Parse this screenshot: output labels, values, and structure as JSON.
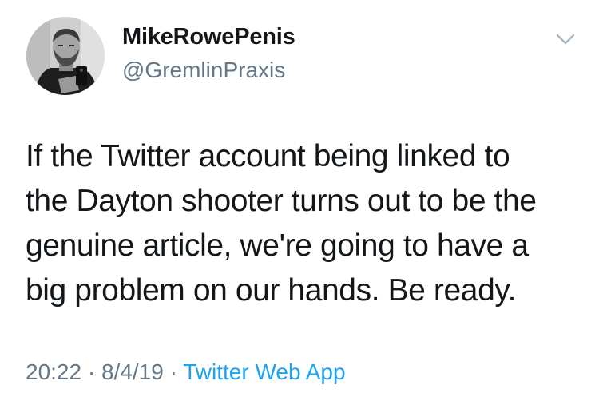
{
  "user": {
    "display_name": "MikeRowePenis",
    "handle": "@GremlinPraxis"
  },
  "tweet": {
    "lines": [
      "If the Twitter account being linked to",
      "the Dayton shooter turns out to be the",
      "genuine article, we're going to have a",
      "big problem on our hands. Be ready."
    ]
  },
  "meta": {
    "time": "20:22",
    "separator": "·",
    "date": "8/4/19",
    "source": "Twitter Web App"
  },
  "icons": {
    "menu": "chevron-down-icon",
    "avatar": "user-avatar"
  },
  "colors": {
    "text": "#14171a",
    "secondary": "#657786",
    "link": "#1da1f2"
  }
}
